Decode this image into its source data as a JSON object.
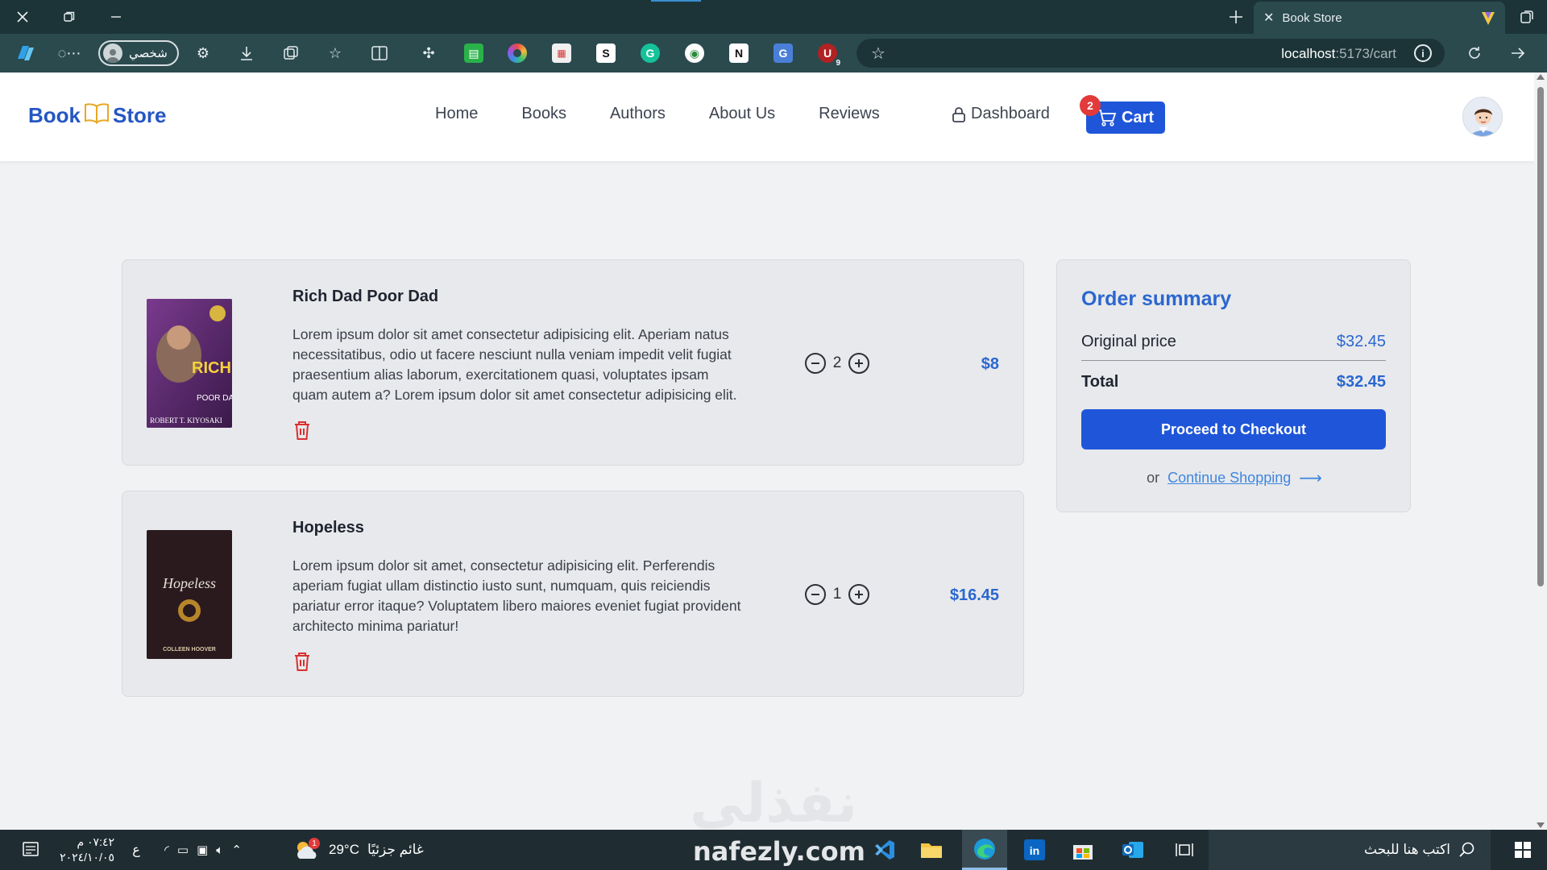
{
  "browser": {
    "tab_title": "Book Store",
    "profile_label": "شخصي",
    "url_host": "localhost",
    "url_path": ":5173/cart",
    "extension_badge": "9"
  },
  "navbar": {
    "brand_left": "Book",
    "brand_right": "Store",
    "links": [
      "Home",
      "Books",
      "Authors",
      "About Us",
      "Reviews"
    ],
    "dashboard_label": "Dashboard",
    "cart_label": "Cart",
    "cart_count": "2"
  },
  "cart_items": [
    {
      "title": "Rich Dad Poor Dad",
      "description": "Lorem ipsum dolor sit amet consectetur adipisicing elit. Aperiam natus necessitatibus, odio ut facere nesciunt nulla veniam impedit velit fugiat praesentium alias laborum, exercitationem quasi, voluptates ipsam quam autem a? Lorem ipsum dolor sit amet consectetur adipisicing elit.",
      "quantity": "2",
      "price": "$8",
      "cover_title": "RICH DAD",
      "cover_subtitle": "POOR DAD",
      "cover_author": "ROBERT T. KIYOSAKI"
    },
    {
      "title": "Hopeless",
      "description": "Lorem ipsum dolor sit amet, consectetur adipisicing elit. Perferendis aperiam fugiat ullam distinctio iusto sunt, numquam, quis reiciendis pariatur error itaque? Voluptatem libero maiores eveniet fugiat provident architecto minima pariatur!",
      "quantity": "1",
      "price": "$16.45",
      "cover_title": "Hopeless",
      "cover_author": "COLLEEN HOOVER"
    }
  ],
  "summary": {
    "title": "Order summary",
    "original_label": "Original price",
    "original_value": "$32.45",
    "total_label": "Total",
    "total_value": "$32.45",
    "checkout_label": "Proceed to Checkout",
    "or_label": "or",
    "continue_label": "Continue Shopping"
  },
  "watermark": {
    "arabic": "نفذلي",
    "latin": "nafezly.com"
  },
  "taskbar": {
    "time": "٠٧:٤٢ م",
    "date": "٢٠٢٤/١٠/٠٥",
    "lang": "ع",
    "temperature": "29°C",
    "weather_text": "غائم جزئيًا",
    "weather_badge": "1",
    "search_placeholder": "اكتب هنا للبحث"
  },
  "colors": {
    "accent": "#1f56d9",
    "price_blue": "#2a67d0",
    "delete_red": "#d93030",
    "badge_red": "#e23a3a"
  }
}
